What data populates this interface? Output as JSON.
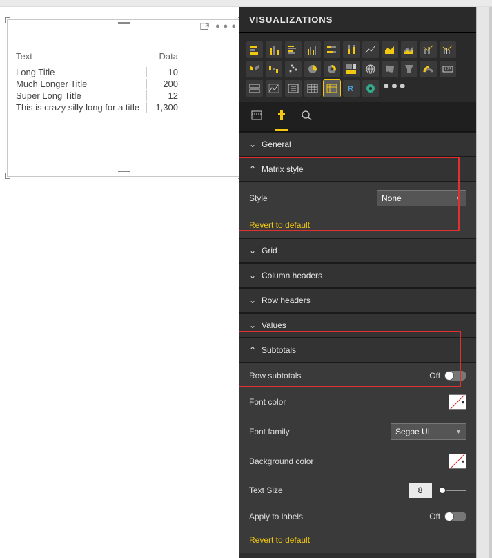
{
  "pane": {
    "title": "VISUALIZATIONS"
  },
  "matrix": {
    "headers": {
      "text": "Text",
      "data": "Data"
    },
    "rows": [
      {
        "text": "Long Title",
        "data": "10"
      },
      {
        "text": "Much Longer Title",
        "data": "200"
      },
      {
        "text": "Super Long Title",
        "data": "12"
      },
      {
        "text": "This is crazy silly long for a title",
        "data": "1,300"
      }
    ]
  },
  "sections": {
    "general": "General",
    "matrix_style": "Matrix style",
    "grid": "Grid",
    "column_headers": "Column headers",
    "row_headers": "Row headers",
    "values": "Values",
    "subtotals": "Subtotals"
  },
  "fields": {
    "style_label": "Style",
    "style_value": "None",
    "revert": "Revert to default",
    "row_subtotals": "Row subtotals",
    "off": "Off",
    "font_color": "Font color",
    "font_family": "Font family",
    "font_family_value": "Segoe UI",
    "background_color": "Background color",
    "text_size": "Text Size",
    "text_size_value": "8",
    "apply_labels": "Apply to labels"
  }
}
